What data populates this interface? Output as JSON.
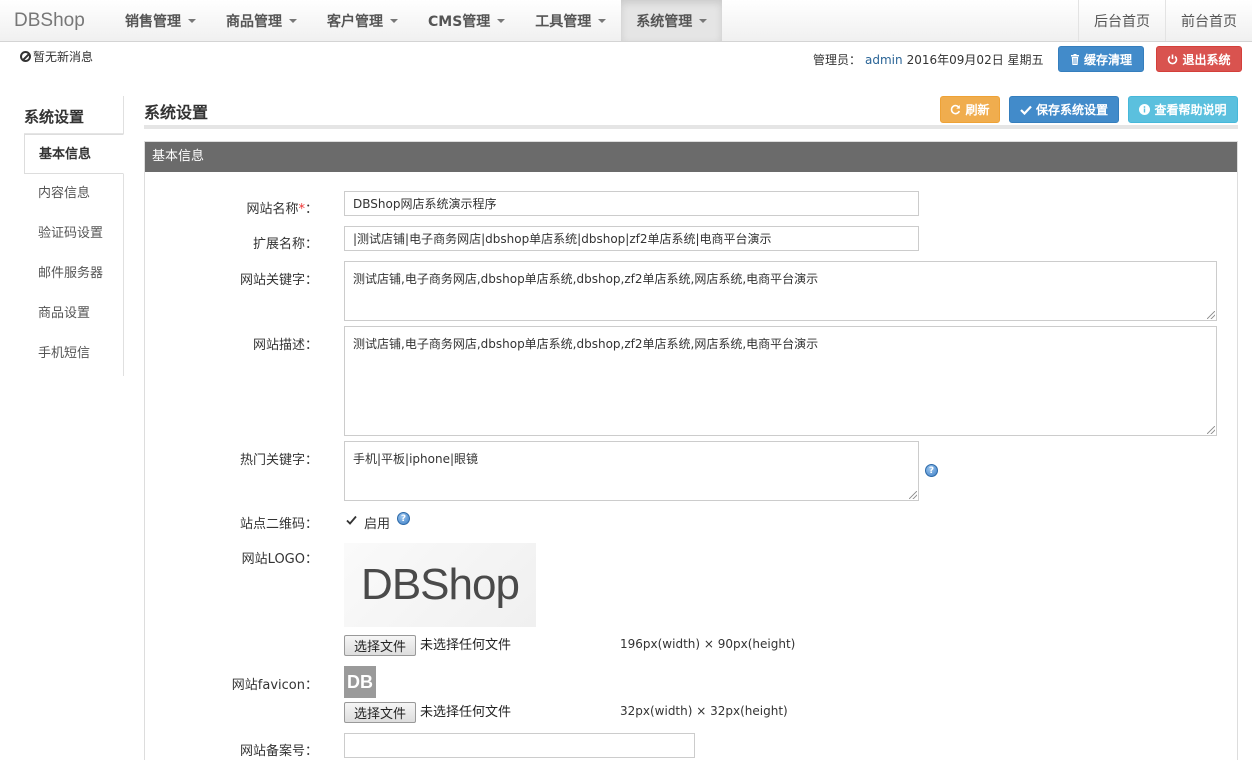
{
  "brand": "DBShop",
  "nav": {
    "items": [
      {
        "label": "销售管理"
      },
      {
        "label": "商品管理"
      },
      {
        "label": "客户管理"
      },
      {
        "label": "CMS管理"
      },
      {
        "label": "工具管理"
      },
      {
        "label": "系统管理"
      }
    ],
    "right": {
      "admin_home": "后台首页",
      "front_home": "前台首页"
    }
  },
  "subbar": {
    "notice": "暂无新消息",
    "admin_prefix": "管理员：",
    "admin_name": "admin",
    "date": "2016年09月02日 星期五",
    "cache_button": "缓存清理",
    "logout_button": "退出系统"
  },
  "sidebar": {
    "title": "系统设置",
    "items": [
      {
        "label": "基本信息"
      },
      {
        "label": "内容信息"
      },
      {
        "label": "验证码设置"
      },
      {
        "label": "邮件服务器"
      },
      {
        "label": "商品设置"
      },
      {
        "label": "手机短信"
      }
    ]
  },
  "main": {
    "title": "系统设置",
    "buttons": {
      "refresh": "刷新",
      "save": "保存系统设置",
      "help": "查看帮助说明"
    },
    "panel_title": "基本信息"
  },
  "form": {
    "site_name": {
      "label": "网站名称",
      "required_mark": "*",
      "colon": "：",
      "value": "DBShop网店系统演示程序"
    },
    "ext_name": {
      "label": "扩展名称：",
      "value": "|测试店铺|电子商务网店|dbshop单店系统|dbshop|zf2单店系统|电商平台演示"
    },
    "keywords": {
      "label": "网站关键字：",
      "value": "测试店铺,电子商务网店,dbshop单店系统,dbshop,zf2单店系统,网店系统,电商平台演示"
    },
    "description": {
      "label": "网站描述：",
      "value": "测试店铺,电子商务网店,dbshop单店系统,dbshop,zf2单店系统,网店系统,电商平台演示"
    },
    "hot_keywords": {
      "label": "热门关键字：",
      "value": "手机|平板|iphone|眼镜"
    },
    "qrcode": {
      "label": "站点二维码：",
      "checkbox_label": "启用",
      "checked": true
    },
    "logo": {
      "label": "网站LOGO：",
      "logo_text": "DBShop",
      "file_button": "选择文件",
      "file_status": "未选择任何文件",
      "dimensions": "196px(width) × 90px(height)"
    },
    "favicon": {
      "label": "网站favicon：",
      "icon_text": "DB",
      "file_button": "选择文件",
      "file_status": "未选择任何文件",
      "dimensions": "32px(width) × 32px(height)"
    },
    "icp": {
      "label": "网站备案号：",
      "value": ""
    }
  },
  "colors": {
    "primary": "#428bca",
    "warning": "#f0ad4e",
    "danger": "#d9534f",
    "info": "#5bc0de",
    "panel_header": "#6b6b6b"
  }
}
